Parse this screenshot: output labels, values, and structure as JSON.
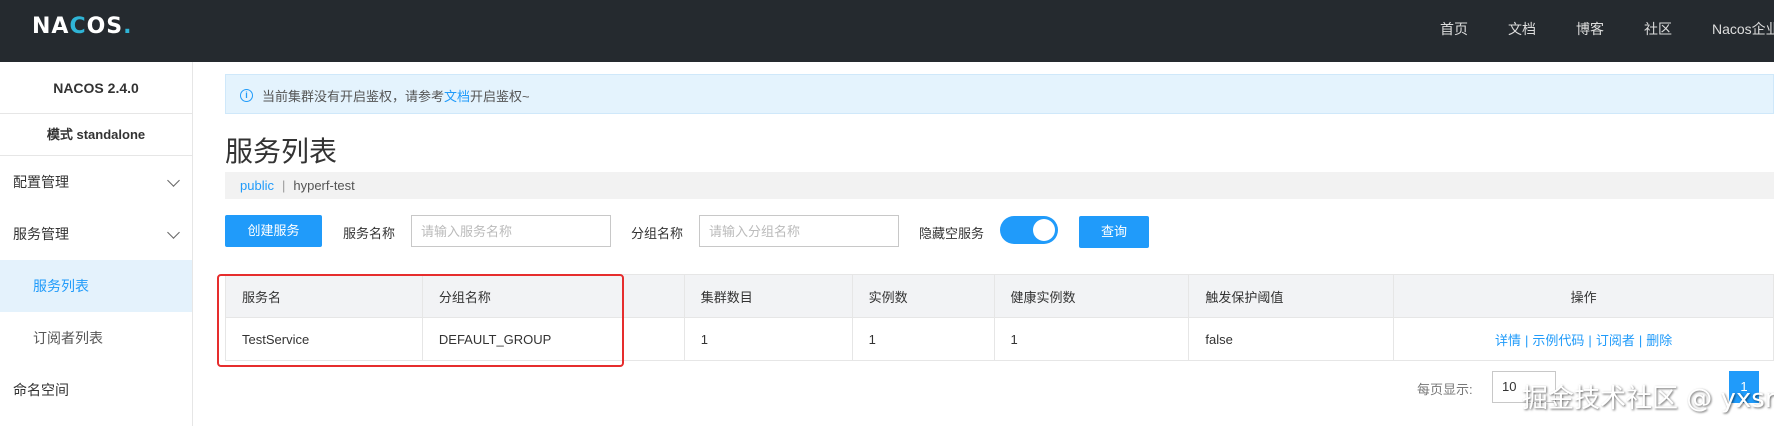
{
  "header": {
    "logo": "NACOS.",
    "nav": [
      "首页",
      "文档",
      "博客",
      "社区",
      "Nacos企业"
    ]
  },
  "sidebar": {
    "version": "NACOS 2.4.0",
    "mode": "模式 standalone",
    "items": [
      {
        "label": "配置管理",
        "expandable": true
      },
      {
        "label": "服务管理",
        "expandable": true
      },
      {
        "label": "服务列表",
        "sub": true,
        "active": true
      },
      {
        "label": "订阅者列表",
        "sub": true,
        "active": false
      },
      {
        "label": "命名空间",
        "expandable": false
      }
    ]
  },
  "notice": {
    "before": "当前集群没有开启鉴权，请参考",
    "link": "文档",
    "after": "开启鉴权~"
  },
  "page": {
    "title": "服务列表",
    "namespace": "public",
    "namespace_current": "hyperf-test"
  },
  "toolbar": {
    "create_label": "创建服务",
    "service_name_label": "服务名称",
    "service_name_placeholder": "请输入服务名称",
    "group_name_label": "分组名称",
    "group_name_placeholder": "请输入分组名称",
    "hide_empty_label": "隐藏空服务",
    "hide_empty_on": true,
    "query_label": "查询"
  },
  "table": {
    "columns": [
      "服务名",
      "分组名称",
      "集群数目",
      "实例数",
      "健康实例数",
      "触发保护阈值",
      "操作"
    ],
    "rows": [
      {
        "service": "TestService",
        "group": "DEFAULT_GROUP",
        "clusters": "1",
        "instances": "1",
        "healthy": "1",
        "threshold": "false",
        "actions": [
          "详情",
          "示例代码",
          "订阅者",
          "删除"
        ]
      }
    ]
  },
  "pagination": {
    "page_size_label": "每页显示:",
    "page_size": "10",
    "current_page": "1"
  },
  "watermark": "掘金技术社区 @ yxsr",
  "colors": {
    "accent": "#209bfa",
    "topbar": "#252a2f",
    "highlight": "#e62d2d"
  }
}
